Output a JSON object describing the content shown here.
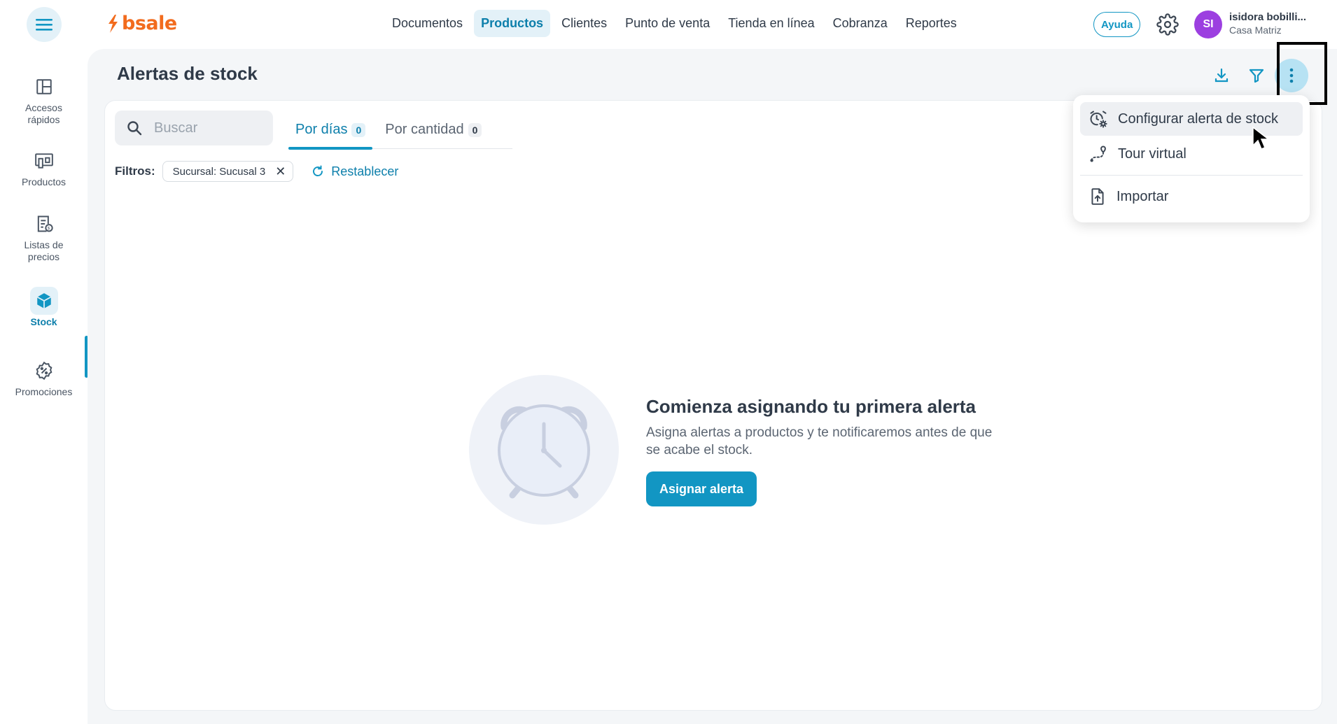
{
  "app": {
    "logo_text": "bsale",
    "brand_color": "#f26b1d",
    "accent_color": "#1296c3"
  },
  "topnav": {
    "items": [
      {
        "label": "Documentos"
      },
      {
        "label": "Productos",
        "active": true
      },
      {
        "label": "Clientes"
      },
      {
        "label": "Punto de venta"
      },
      {
        "label": "Tienda en línea"
      },
      {
        "label": "Cobranza"
      },
      {
        "label": "Reportes"
      }
    ],
    "help_label": "Ayuda",
    "settings_icon": "gear-icon"
  },
  "user": {
    "initials": "SI",
    "name": "isidora bobilli...",
    "branch": "Casa Matriz",
    "avatar_color": "#9c3fe0"
  },
  "sidebar": {
    "items": [
      {
        "label": "Accesos rápidos",
        "icon": "layout-icon"
      },
      {
        "label": "Productos",
        "icon": "products-icon"
      },
      {
        "label": "Listas de precios",
        "icon": "price-list-icon"
      },
      {
        "label": "Stock",
        "icon": "box-icon",
        "active": true
      },
      {
        "label": "Promociones",
        "icon": "percent-badge-icon"
      }
    ]
  },
  "page": {
    "title": "Alertas de stock"
  },
  "search": {
    "placeholder": "Buscar",
    "value": ""
  },
  "tabs": [
    {
      "label": "Por días",
      "count": "0",
      "active": true
    },
    {
      "label": "Por cantidad",
      "count": "0"
    }
  ],
  "filters": {
    "label": "Filtros:",
    "chips": [
      {
        "label": "Sucursal: Sucusal 3"
      }
    ],
    "reset_label": "Restablecer"
  },
  "empty_state": {
    "title": "Comienza asignando tu primera alerta",
    "description": "Asigna alertas a productos y te notificaremos antes de que se acabe el stock.",
    "button_label": "Asignar alerta"
  },
  "menu": {
    "items": [
      {
        "label": "Configurar alerta de stock",
        "icon": "alarm-gear-icon",
        "hovered": true
      },
      {
        "label": "Tour virtual",
        "icon": "route-icon"
      },
      {
        "label": "Importar",
        "icon": "file-upload-icon"
      }
    ]
  }
}
